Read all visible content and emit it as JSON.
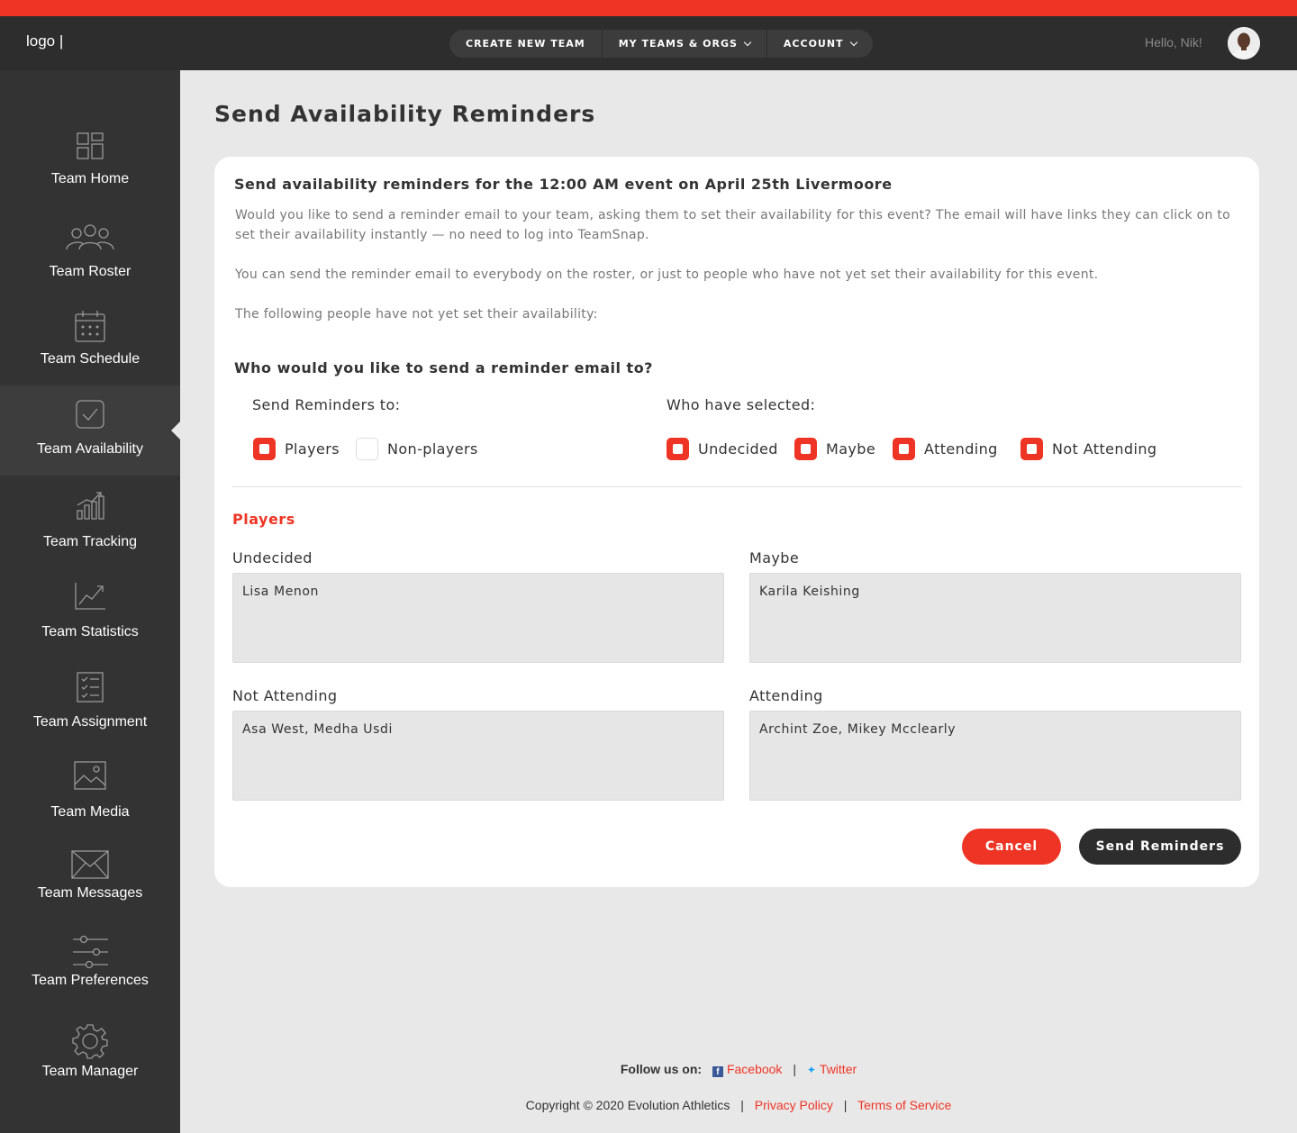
{
  "header": {
    "logo": "logo |",
    "nav": [
      "CREATE NEW TEAM",
      "MY TEAMS & ORGS",
      "ACCOUNT"
    ],
    "greeting": "Hello, Nik!"
  },
  "sidebar": {
    "items": [
      {
        "label": "Team Home",
        "icon": "dashboard-icon"
      },
      {
        "label": "Team Roster",
        "icon": "group-icon"
      },
      {
        "label": "Team Schedule",
        "icon": "calendar-icon"
      },
      {
        "label": "Team Availability",
        "icon": "checkbox-icon",
        "active": true
      },
      {
        "label": "Team Tracking",
        "icon": "bar-chart-icon"
      },
      {
        "label": "Team Statistics",
        "icon": "trend-line-icon"
      },
      {
        "label": "Team Assignment",
        "icon": "checklist-icon"
      },
      {
        "label": "Team Media",
        "icon": "image-icon"
      },
      {
        "label": "Team Messages",
        "icon": "envelope-icon"
      },
      {
        "label": "Team Preferences",
        "icon": "sliders-icon"
      },
      {
        "label": "Team Manager",
        "icon": "gear-icon"
      }
    ]
  },
  "main": {
    "title": "Send Availability Reminders",
    "heading": "Send availability reminders for the 12:00 AM event on April 25th  Livermoore",
    "para1": "Would you like to send a reminder email to your team, asking them to set their availability for this event? The email will have links they can click on to set their availability instantly — no need to log into TeamSnap.",
    "para2": "You can send the reminder email to everybody on the roster, or just to people who have not yet set their availability for this event.",
    "para3": "The following people have not yet set their availability:",
    "question": "Who would you like to send a reminder email to?",
    "send_to_label": "Send Reminders to:",
    "selected_label": "Who have selected:",
    "send_to": [
      {
        "label": "Players",
        "checked": true
      },
      {
        "label": "Non-players",
        "checked": false
      }
    ],
    "selected": [
      {
        "label": "Undecided",
        "checked": true
      },
      {
        "label": "Maybe",
        "checked": true
      },
      {
        "label": "Attending",
        "checked": true
      },
      {
        "label": "Not Attending",
        "checked": true
      }
    ],
    "section": "Players",
    "fields": {
      "undecided": {
        "label": "Undecided",
        "value": "Lisa Menon"
      },
      "maybe": {
        "label": "Maybe",
        "value": "Karila Keishing"
      },
      "not_attending": {
        "label": "Not Attending",
        "value": "Asa West, Medha Usdi"
      },
      "attending": {
        "label": "Attending",
        "value": "Archint Zoe, Mikey Mcclearly"
      }
    },
    "cancel": "Cancel",
    "send": "Send Reminders"
  },
  "footer": {
    "follow": "Follow us on:",
    "facebook": "Facebook",
    "twitter": "Twitter",
    "copyright": "Copyright © 2020 Evolution Athletics",
    "privacy": "Privacy Policy",
    "terms": "Terms of Service"
  },
  "colors": {
    "accent": "#ee3424",
    "dark": "#2d2d2d",
    "sidebar": "#333333"
  }
}
